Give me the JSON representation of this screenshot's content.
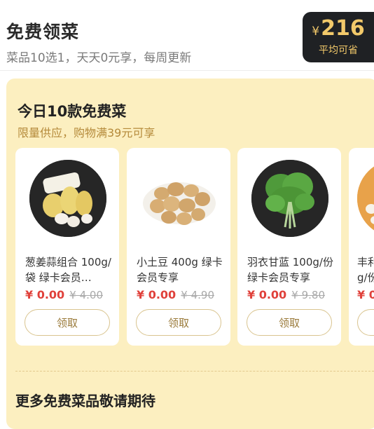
{
  "header": {
    "title": "免费领菜",
    "subtitle": "菜品10选1，天天0元享，每周更新"
  },
  "savings": {
    "currency": "¥",
    "amount": "216",
    "caption": "平均可省"
  },
  "panel": {
    "title": "今日10款免费菜",
    "subtitle": "限量供应，购物满39元可享"
  },
  "products": [
    {
      "name": "葱姜蒜组合 100g/袋 绿卡会员…",
      "price": "¥ 0.00",
      "original_price": "¥ 4.00",
      "button_label": "领取",
      "icon": "garlic-ginger-scallion-icon"
    },
    {
      "name": "小土豆 400g 绿卡会员专享",
      "price": "¥ 0.00",
      "original_price": "¥ 4.90",
      "button_label": "领取",
      "icon": "potato-icon"
    },
    {
      "name": "羽衣甘蓝 100g/份 绿卡会员专享",
      "price": "¥ 0.00",
      "original_price": "¥ 9.80",
      "button_label": "领取",
      "icon": "kale-icon"
    },
    {
      "name": "丰利…g/份…",
      "price": "¥ 0",
      "original_price": "",
      "button_label": "",
      "icon": "vegetable-icon"
    }
  ],
  "footer": {
    "more_title": "更多免费菜品敬请期待"
  },
  "colors": {
    "panel_bg": "#fcefc0",
    "price_red": "#e0413b",
    "badge_bg": "#1f2124",
    "badge_gold": "#f2c96a"
  }
}
